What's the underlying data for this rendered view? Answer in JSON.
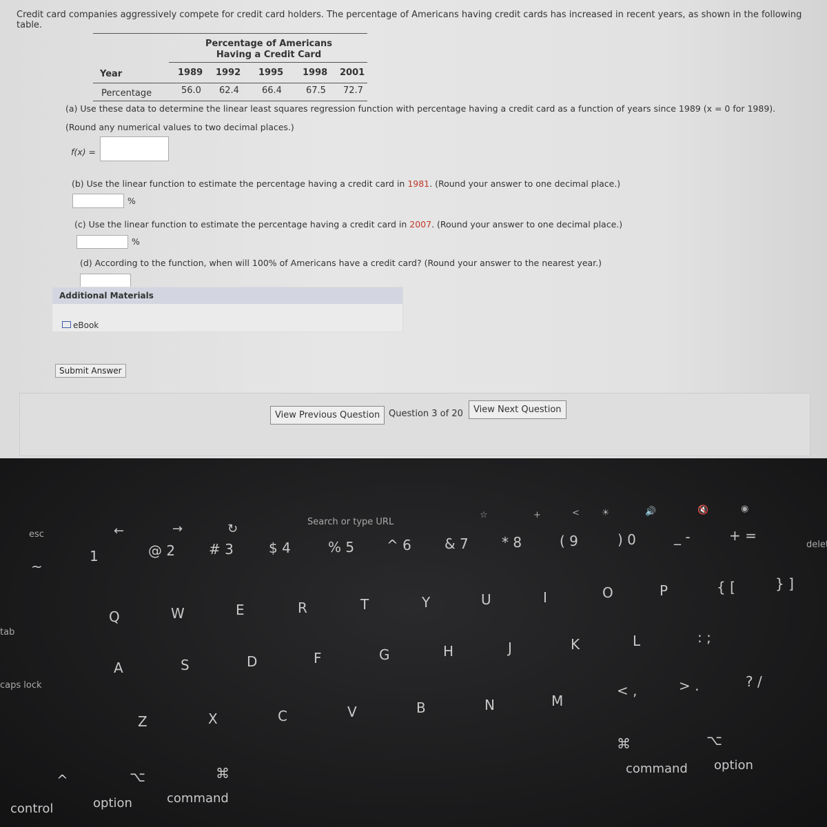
{
  "intro": "Credit card companies aggressively compete for credit card holders. The percentage of Americans having credit cards has increased in recent years, as shown in the following table.",
  "table": {
    "title_line1": "Percentage of Americans",
    "title_line2": "Having a Credit Card",
    "row_labels": [
      "Year",
      "Percentage"
    ],
    "years": [
      "1989",
      "1992",
      "1995",
      "1998",
      "2001"
    ],
    "percentages": [
      "56.0",
      "62.4",
      "66.4",
      "67.5",
      "72.7"
    ]
  },
  "part_a": {
    "line1": "(a) Use these data to determine the linear least squares regression function with percentage having a credit card as a function of years since 1989 (x = 0 for 1989).",
    "line2": "(Round any numerical values to two decimal places.)",
    "label": "f(x) =",
    "value": ""
  },
  "part_b": {
    "pre": "(b) Use the linear function to estimate the percentage having a credit card in ",
    "year": "1981",
    "post": ". (Round your answer to one decimal place.)",
    "unit": "%",
    "value": ""
  },
  "part_c": {
    "pre": "(c) Use the linear function to estimate the percentage having a credit card in ",
    "year": "2007",
    "post": ". (Round your answer to one decimal place.)",
    "unit": "%",
    "value": ""
  },
  "part_d": {
    "text": "(d) According to the function, when will 100% of Americans have a credit card? (Round your answer to the nearest year.)",
    "value": ""
  },
  "additional": {
    "title": "Additional Materials",
    "ebook": "eBook"
  },
  "submit": "Submit Answer",
  "nav": {
    "prev": "View Previous Question",
    "status": "Question 3 of 20",
    "next": "View Next Question"
  },
  "keyboard": {
    "touchbar": [
      "esc",
      "←",
      "→",
      "↻",
      "Search or type URL",
      "☆",
      "+",
      "<",
      "☀",
      "🔊",
      "🔇",
      "◉"
    ],
    "numbers": [
      "~",
      "1",
      "@ 2",
      "# 3",
      "$ 4",
      "% 5",
      "^ 6",
      "& 7",
      "* 8",
      "( 9",
      ") 0",
      "_ -",
      "+ =",
      "delete"
    ],
    "qrow": [
      "tab",
      "Q",
      "W",
      "E",
      "R",
      "T",
      "Y",
      "U",
      "I",
      "O",
      "P",
      "{ [",
      "} ]"
    ],
    "arow": [
      "caps lock",
      "A",
      "S",
      "D",
      "F",
      "G",
      "H",
      "J",
      "K",
      "L",
      ": ;"
    ],
    "zrow": [
      "Z",
      "X",
      "C",
      "V",
      "B",
      "N",
      "M",
      "< ,",
      "> .",
      "? /"
    ],
    "bottom": [
      "^",
      "control",
      "⌥",
      "option",
      "⌘",
      "command",
      "⌘",
      "command",
      "⌥",
      "option"
    ]
  }
}
